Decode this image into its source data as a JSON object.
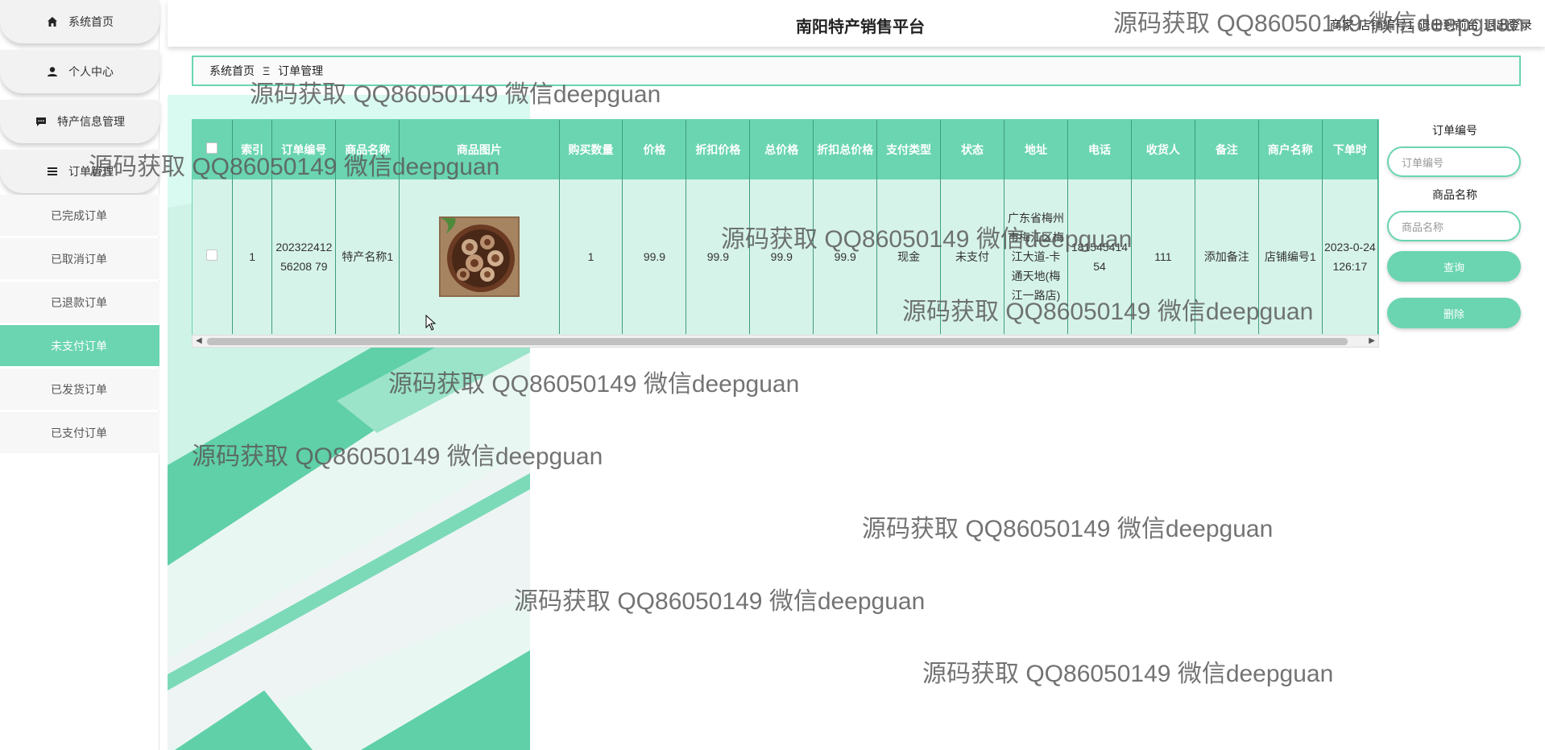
{
  "header": {
    "title": "南阳特产销售平台",
    "links": [
      "商家",
      "店铺编号1",
      "退出到前台",
      "退出登录"
    ]
  },
  "sidebar": {
    "main_items": [
      {
        "label": "系统首页",
        "icon": "home-icon"
      },
      {
        "label": "个人中心",
        "icon": "user-icon"
      },
      {
        "label": "特产信息管理",
        "icon": "chat-icon"
      },
      {
        "label": "订单管理",
        "icon": "list-icon"
      }
    ],
    "sub_items": [
      "已完成订单",
      "已取消订单",
      "已退款订单",
      "未支付订单",
      "已发货订单",
      "已支付订单"
    ],
    "active_sub": "未支付订单"
  },
  "breadcrumb": {
    "home": "系统首页",
    "separator": "Ξ",
    "current": "订单管理"
  },
  "table": {
    "columns": [
      "索引",
      "订单编号",
      "商品名称",
      "商品图片",
      "购买数量",
      "价格",
      "折扣价格",
      "总价格",
      "折扣总价格",
      "支付类型",
      "状态",
      "地址",
      "电话",
      "收货人",
      "备注",
      "商户名称",
      "下单时"
    ],
    "rows": [
      {
        "index": "1",
        "order_no": "20232241256208 79",
        "product_name": "特产名称1",
        "quantity": "1",
        "price": "99.9",
        "discount_price": "99.9",
        "total_price": "99.9",
        "discount_total": "99.9",
        "pay_type": "现金",
        "status": "未支付",
        "address": "广东省梅州市梅江区梅江大道-卡通天地(梅江一路店)",
        "phone": "18154541454",
        "receiver": "111",
        "remark": "添加备注",
        "merchant": "店铺编号1",
        "order_time": "2023-0-24 126:17"
      }
    ]
  },
  "search": {
    "order_no_label": "订单编号",
    "order_no_placeholder": "订单编号",
    "product_label": "商品名称",
    "product_placeholder": "商品名称",
    "query_button": "查询",
    "delete_button": "删除"
  },
  "watermark": "源码获取 QQ86050149 微信deepguan",
  "colors": {
    "accent": "#6ad5b0",
    "table_bg": "#d6f3ea"
  }
}
